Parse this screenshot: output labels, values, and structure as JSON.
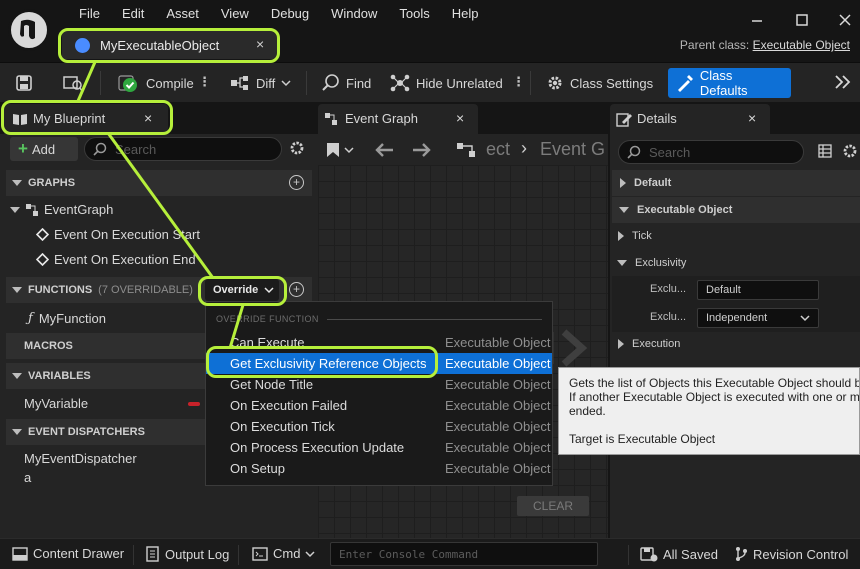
{
  "menu": [
    "File",
    "Edit",
    "Asset",
    "View",
    "Debug",
    "Window",
    "Tools",
    "Help"
  ],
  "asset_tab": {
    "label": "MyExecutableObject",
    "close": "×"
  },
  "parent_class": {
    "label": "Parent class:",
    "value": "Executable Object"
  },
  "toolbar": {
    "compile": "Compile",
    "diff": "Diff",
    "find": "Find",
    "hide_unrelated": "Hide Unrelated",
    "class_settings": "Class Settings",
    "class_defaults": "Class Defaults"
  },
  "my_blueprint": {
    "tab_label": "My Blueprint",
    "add_label": "Add",
    "search_placeholder": "Search",
    "graphs_header": "GRAPHS",
    "event_graph": "EventGraph",
    "events": [
      "Event On Execution Start",
      "Event On Execution End"
    ],
    "functions_header": "FUNCTIONS",
    "functions_count": "(7 OVERRIDABLE)",
    "override_label": "Override",
    "function_item": "MyFunction",
    "macros_header": "MACROS",
    "variables_header": "VARIABLES",
    "variable_item": "MyVariable",
    "dispatchers_header": "EVENT DISPATCHERS",
    "dispatcher_item_line1": "MyEventDispatcher",
    "dispatcher_item_line2": "a"
  },
  "event_graph": {
    "tab_label": "Event Graph",
    "breadcrumb_partial": "ect",
    "breadcrumb_next": "Event G",
    "clear_label": "CLEAR"
  },
  "override_menu": {
    "header": "OVERRIDE FUNCTION",
    "items": [
      {
        "name": "Can Execute",
        "type": "Executable Object"
      },
      {
        "name": "Get Exclusivity Reference Objects",
        "type": "Executable Object"
      },
      {
        "name": "Get Node Title",
        "type": "Executable Object"
      },
      {
        "name": "On Execution Failed",
        "type": "Executable Object"
      },
      {
        "name": "On Execution Tick",
        "type": "Executable Object"
      },
      {
        "name": "On Process Execution Update",
        "type": "Executable Object"
      },
      {
        "name": "On Setup",
        "type": "Executable Object"
      }
    ]
  },
  "tooltip": {
    "line1": "Gets the list of Objects this Executable Object should b",
    "line2": "If another Executable Object is executed with one or mo",
    "line3": "ended.",
    "line4": "Target is Executable Object"
  },
  "details": {
    "tab_label": "Details",
    "search_placeholder": "Search",
    "default_header": "Default",
    "executable_object_header": "Executable Object",
    "tick": "Tick",
    "exclusivity": "Exclusivity",
    "row_label_1": "Exclu...",
    "row_value_1": "Default",
    "row_label_2": "Exclu...",
    "row_value_2": "Independent",
    "execution": "Execution"
  },
  "statusbar": {
    "content_drawer": "Content Drawer",
    "output_log": "Output Log",
    "cmd": "Cmd",
    "console_placeholder": "Enter Console Command",
    "all_saved": "All Saved",
    "revision_control": "Revision Control"
  },
  "colors": {
    "accent": "#0e70d6",
    "highlight": "#b6ef3b",
    "panel": "#242424",
    "background": "#151515"
  }
}
